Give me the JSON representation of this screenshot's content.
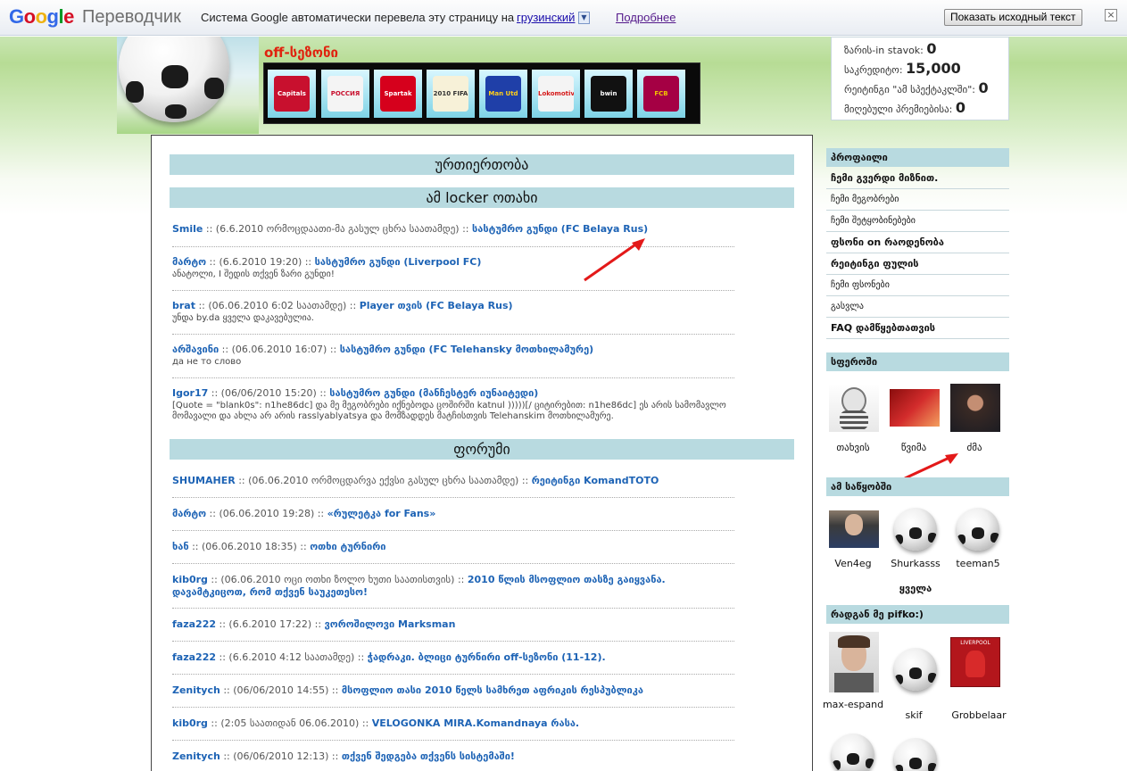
{
  "translate_bar": {
    "logo": [
      "G",
      "o",
      "o",
      "g",
      "l",
      "e"
    ],
    "product": "Переводчик",
    "message": "Система Google автоматически перевела эту страницу на",
    "language": "грузинский",
    "more": "Подробнее",
    "show_original": "Показать исходный текст",
    "close": "×"
  },
  "header": {
    "season": "off-სეზონი",
    "club_logos": [
      "Capitals",
      "РОССИЯ",
      "Spartak",
      "2010 FIFA",
      "Man Utd",
      "Lokomotiv",
      "bwin",
      "FCB"
    ]
  },
  "stats": [
    {
      "label": "ზარის-in stavok:",
      "value": "0"
    },
    {
      "label": "საკრედიტო:",
      "value": "15,000"
    },
    {
      "label": "რეიტინგი \"ამ სპექტაკლში\":",
      "value": "0"
    },
    {
      "label": "მიღებული პრემიებისა:",
      "value": "0"
    }
  ],
  "main": {
    "section_relations": "ურთიერთობა",
    "section_locker": "ამ locker ოთახი",
    "locker_entries": [
      {
        "user": "Smile",
        "meta": " :: (6.6.2010 ორმოცდაათი-მა გასულ ცხრა საათამდე) :: ",
        "link": "სასტუმრო გუნდი (FC Belaya Rus)",
        "body": ""
      },
      {
        "user": "მარტო",
        "meta": " :: (6.6.2010 19:20) :: ",
        "link": "სასტუმრო გუნდი (Liverpool FC)",
        "body": "ანატოლი, I შედის თქვენ ზარი გუნდი!"
      },
      {
        "user": "brat",
        "meta": " :: (06.06.2010 6:02 საათამდე) :: ",
        "link": "Player თვის (FC Belaya Rus)",
        "body": "უნდა by.da ყველა დაკავებულია."
      },
      {
        "user": "არშავინი",
        "meta": " :: (06.06.2010 16:07) :: ",
        "link": "სასტუმრო გუნდი (FC Telehansky მოთხილამურე)",
        "body": "да не то слово"
      },
      {
        "user": "Igor17",
        "meta": " :: (06/06/2010 15:20) :: ",
        "link": "სასტუმრო გუნდი (მანჩესტერ იუნაიტედი)",
        "body": "[Quote = \"blank0s\": n1he86dc] და მე მეგობრები იქნებოდა ცოშირში katnul )))))[/ ციტირებით: n1he86dc] ეს არის სამომავლო მომავალი და ახლა არ არის rasslyablyatsya და მომზადდეს მატჩისთვის Telehanskim მოთხილამურე."
      }
    ],
    "section_forum": "ფორუმი",
    "forum_entries": [
      {
        "user": "SHUMAHER",
        "meta": " :: (06.06.2010 ორმოცდარვა ექვსი გასულ ცხრა საათამდე) :: ",
        "link": "რეიტინგი KomandTOTO"
      },
      {
        "user": "მარტო",
        "meta": " :: (06.06.2010 19:28) :: ",
        "link": "«რულეტკა for Fans»"
      },
      {
        "user": "ხან",
        "meta": " :: (06.06.2010 18:35) :: ",
        "link": "ოთხი ტურნირი"
      },
      {
        "user": "kib0rg",
        "meta": " :: (06.06.2010 ოცი ოთხი ზოლო ხუთი საათისთვის) :: ",
        "link": "2010 წლის მსოფლიო თასზე გაიყვანა. დავამტკიცოთ, რომ თქვენ საუკეთესო!"
      },
      {
        "user": "faza222",
        "meta": " :: (6.6.2010 17:22) :: ",
        "link": "ვოროშილოვი Marksman"
      },
      {
        "user": "faza222",
        "meta": " :: (6.6.2010 4:12 საათამდე) :: ",
        "link": "ჭადრაკი. ბლიცი ტურნირი off-სეზონი (11-12)."
      },
      {
        "user": "Zenitych",
        "meta": " :: (06/06/2010 14:55) :: ",
        "link": "მსოფლიო თასი 2010 წელს სამხრეთ აფრიკის რესპუბლიკა"
      },
      {
        "user": "kib0rg",
        "meta": " :: (2:05 საათიდან 06.06.2010) :: ",
        "link": "VELOGONKA MIRA.Komandnaya რასა."
      },
      {
        "user": "Zenitych",
        "meta": " :: (06/06/2010 12:13) :: ",
        "link": "თქვენ შედგება თქვენს სისტემაში!"
      }
    ]
  },
  "sidebar": {
    "profile_header": "პროფაილი",
    "menu": [
      {
        "label": "ჩემი გვერდი მიზნით.",
        "bold": true
      },
      {
        "label": "ჩემი მეგობრები",
        "bold": false
      },
      {
        "label": "ჩემი შეტყობინებები",
        "bold": false
      },
      {
        "label": "ფსონი on რაოდენობა",
        "bold": true
      },
      {
        "label": "რეიტინგი ფულის",
        "bold": true
      },
      {
        "label": "ჩემი ფსონები",
        "bold": false
      },
      {
        "label": "გასვლა",
        "bold": false
      },
      {
        "label": "FAQ დამწყებთათვის",
        "bold": true
      }
    ],
    "sphere_header": "სფეროში",
    "sphere": [
      {
        "name": "თახვის"
      },
      {
        "name": "წვიმა"
      },
      {
        "name": "ძმა"
      }
    ],
    "community_header": "ამ საწყობში",
    "community": [
      {
        "name": "Ven4eg"
      },
      {
        "name": "Shurkasss"
      },
      {
        "name": "teeman5"
      }
    ],
    "all_link": "ყველა",
    "since_header": "რადგან მე pifko:)",
    "since": [
      {
        "name": "max-espand"
      },
      {
        "name": "skif"
      },
      {
        "name": "Grobbelaar"
      }
    ]
  }
}
